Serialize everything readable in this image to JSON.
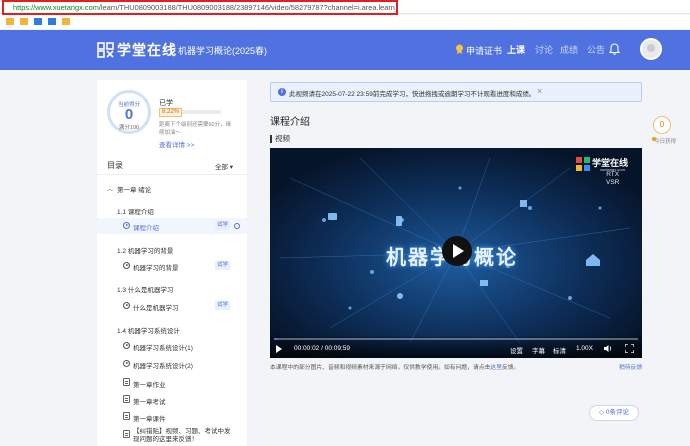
{
  "browser": {
    "url_secure": "https://www.xuetangx.com",
    "url_rest": "/learn/THU08090031​88/THU08090031​88/23897146/video/58279787?channel=i.area.learn_title"
  },
  "header": {
    "logo_text": "学堂在线",
    "course_title": "机器学习概论(2025春)",
    "cert_label": "申请证书",
    "nav": [
      "上课",
      "讨论",
      "成绩",
      "公告"
    ]
  },
  "progress_card": {
    "ring_label": "当前得分",
    "score": "0",
    "full_score": "满分100",
    "learned_label": "已学",
    "progress_pct": "8.22%",
    "progress_value": 0.0822,
    "hint": "距离下个级别还需要60分，继续加油～",
    "detail_link": "查看详情 >>"
  },
  "toc": {
    "title": "目录",
    "filter": "全部 ▾",
    "rows": [
      {
        "type": "chapter",
        "label": "第一章 绪论"
      },
      {
        "type": "section",
        "label": "1.1 课程介绍"
      },
      {
        "type": "video",
        "label": "课程介绍",
        "tag": "试学",
        "active": true
      },
      {
        "type": "section",
        "label": "1.2 机器学习的背景"
      },
      {
        "type": "video",
        "label": "机器学习的背景",
        "tag": "试学"
      },
      {
        "type": "section",
        "label": "1.3 什么是机器学习"
      },
      {
        "type": "video",
        "label": "什么是机器学习",
        "tag": "试学"
      },
      {
        "type": "section",
        "label": "1.4 机器学习系统设计"
      },
      {
        "type": "video",
        "label": "机器学习系统设计(1)"
      },
      {
        "type": "video",
        "label": "机器学习系统设计(2)"
      },
      {
        "type": "doc",
        "label": "第一章作业"
      },
      {
        "type": "doc",
        "label": "第一章考试"
      },
      {
        "type": "doc",
        "label": "第一章课件"
      },
      {
        "type": "doc",
        "label": "【纠错贴】视频、习题、考试中发现问题的这里来反馈！"
      }
    ]
  },
  "notice": {
    "text": "此视频请在2025-07-22 23:59前完成学习，快进拖拽或逾期学习不计观看进度和成绩。"
  },
  "main": {
    "section_title": "课程介绍",
    "video_label": "视频"
  },
  "video": {
    "logo_text": "学堂在线",
    "logo_url": "xuetangx.com",
    "badge_line1": "RTX",
    "badge_line2": "VSR",
    "title": "机器学习概论",
    "time": "00:00:02 / 00:09:59",
    "progress_value": 0.0033,
    "controls": [
      "设置",
      "字幕",
      "标清",
      "1.00X"
    ]
  },
  "footer": {
    "disclaimer": "本课程中的部分图片、音频和视频素材来源于网络，仅供教学使用。如有问题，请点击",
    "disclaimer_link": "这里",
    "disclaimer_end": "反馈。",
    "right_link": "稍待反馈",
    "comments": "◇ 0条评论"
  },
  "side": {
    "count": "0",
    "label": "今日获得"
  }
}
